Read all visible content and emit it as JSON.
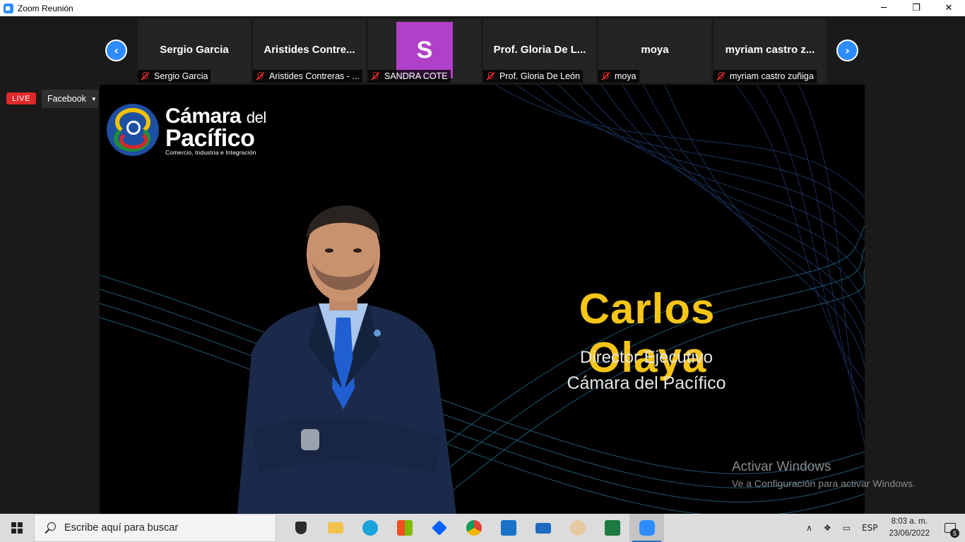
{
  "window": {
    "title": "Zoom Reunión",
    "minimize": "─",
    "maximize": "❐",
    "close": "✕"
  },
  "gallery": {
    "prev": "‹",
    "next": "›",
    "participants": [
      {
        "name": "Sergio Garcia",
        "label": "Sergio Garcia"
      },
      {
        "name": "Aristides  Contre...",
        "label": "Aristides Contreras - ..."
      },
      {
        "name": "",
        "avatar_letter": "S",
        "avatar_color": "#b040c8",
        "label": "SANDRA COTE"
      },
      {
        "name": "Prof. Gloria De L...",
        "label": "Prof. Gloria De León"
      },
      {
        "name": "moya",
        "label": "moya"
      },
      {
        "name": "myriam castro z...",
        "label": "myriam castro zuñiga"
      }
    ]
  },
  "live": {
    "badge": "LIVE",
    "platform": "Facebook",
    "caret": "▼"
  },
  "shared_screen": {
    "logo_line1": "Cámara",
    "logo_line1_small": "del",
    "logo_line2": "Pacífico",
    "logo_tagline": "Comercio, Industria e Integración",
    "speaker_name": "Carlos Olaya",
    "speaker_role": "Director Ejecutivo",
    "speaker_org": "Cámara del Pacífico",
    "accent_color": "#f5c518"
  },
  "watermark": {
    "title": "Activar Windows",
    "subtitle": "Ve a Configuración para activar Windows."
  },
  "taskbar": {
    "search_placeholder": "Escribe aquí para buscar",
    "apps": [
      "shield-icon",
      "file-explorer-icon",
      "edge-icon",
      "store-icon",
      "dropbox-icon",
      "chrome-icon",
      "outlook-icon",
      "mail-icon",
      "paint-icon",
      "excel-icon",
      "zoom-icon"
    ],
    "tray_chevron": "∧",
    "language": "ESP",
    "time": "8:03 a. m.",
    "date": "23/06/2022",
    "notifications": "5"
  }
}
